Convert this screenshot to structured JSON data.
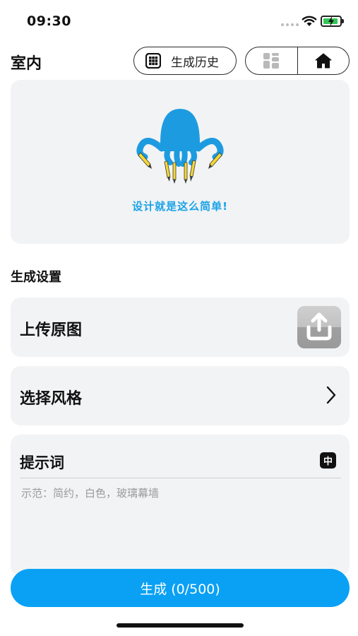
{
  "status_bar": {
    "time": "09:30"
  },
  "header": {
    "title": "室内",
    "history_label": "生成历史",
    "icons": [
      "grid-icon",
      "gallery-icon",
      "home-icon"
    ]
  },
  "hero": {
    "slogan": "设计就是这么简单!"
  },
  "settings": {
    "section_title": "生成设置",
    "upload_label": "上传原图",
    "style_label": "选择风格",
    "prompt_label": "提示词",
    "prompt_lang": "中",
    "prompt_placeholder": "示范：简约，白色，玻璃幕墙",
    "prompt_value": ""
  },
  "generate_label": "生成 (0/500)",
  "colors": {
    "accent": "#0aa1f5",
    "slogan": "#1aa3e8",
    "card_bg": "#f2f3f5",
    "mascot": "#1d9be0",
    "pencil": "#f5d832"
  }
}
